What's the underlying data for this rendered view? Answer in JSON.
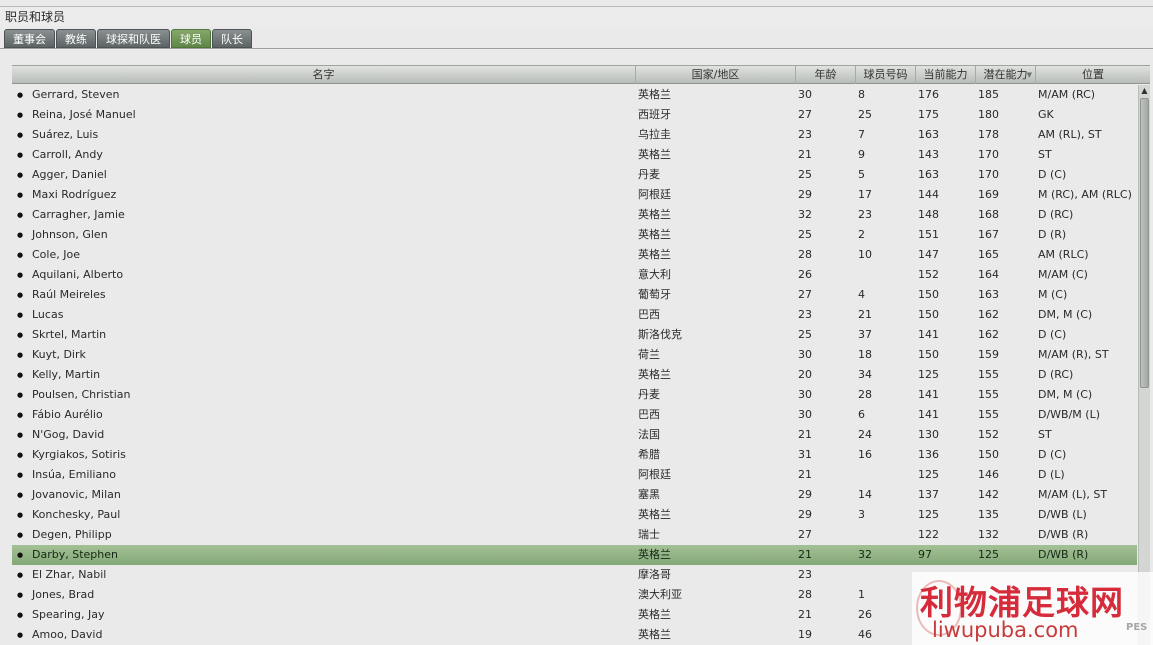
{
  "window": {
    "title": "职员和球员"
  },
  "tabs": [
    {
      "label": "董事会",
      "active": false
    },
    {
      "label": "教练",
      "active": false
    },
    {
      "label": "球探和队医",
      "active": false
    },
    {
      "label": "球员",
      "active": true
    },
    {
      "label": "队长",
      "active": false
    }
  ],
  "table": {
    "headers": {
      "name": "名字",
      "country": "国家/地区",
      "age": "年龄",
      "shirt": "球员号码",
      "ca": "当前能力",
      "pa": "潜在能力",
      "pos": "位置"
    },
    "sorted_by": "pa",
    "sort_icon": "sort-descending-icon",
    "selected_row": 23,
    "rows": [
      {
        "name": "Gerrard, Steven",
        "country": "英格兰",
        "age": "30",
        "shirt": "8",
        "ca": "176",
        "pa": "185",
        "pos": "M/AM (RC)"
      },
      {
        "name": "Reina, José Manuel",
        "country": "西班牙",
        "age": "27",
        "shirt": "25",
        "ca": "175",
        "pa": "180",
        "pos": "GK"
      },
      {
        "name": "Suárez, Luis",
        "country": "乌拉圭",
        "age": "23",
        "shirt": "7",
        "ca": "163",
        "pa": "178",
        "pos": "AM (RL), ST"
      },
      {
        "name": "Carroll, Andy",
        "country": "英格兰",
        "age": "21",
        "shirt": "9",
        "ca": "143",
        "pa": "170",
        "pos": "ST"
      },
      {
        "name": "Agger, Daniel",
        "country": "丹麦",
        "age": "25",
        "shirt": "5",
        "ca": "163",
        "pa": "170",
        "pos": "D (C)"
      },
      {
        "name": "Maxi Rodríguez",
        "country": "阿根廷",
        "age": "29",
        "shirt": "17",
        "ca": "144",
        "pa": "169",
        "pos": "M (RC), AM (RLC)"
      },
      {
        "name": "Carragher, Jamie",
        "country": "英格兰",
        "age": "32",
        "shirt": "23",
        "ca": "148",
        "pa": "168",
        "pos": "D (RC)"
      },
      {
        "name": "Johnson, Glen",
        "country": "英格兰",
        "age": "25",
        "shirt": "2",
        "ca": "151",
        "pa": "167",
        "pos": "D (R)"
      },
      {
        "name": "Cole, Joe",
        "country": "英格兰",
        "age": "28",
        "shirt": "10",
        "ca": "147",
        "pa": "165",
        "pos": "AM (RLC)"
      },
      {
        "name": "Aquilani, Alberto",
        "country": "意大利",
        "age": "26",
        "shirt": "",
        "ca": "152",
        "pa": "164",
        "pos": "M/AM (C)"
      },
      {
        "name": "Raúl Meireles",
        "country": "葡萄牙",
        "age": "27",
        "shirt": "4",
        "ca": "150",
        "pa": "163",
        "pos": "M (C)"
      },
      {
        "name": "Lucas",
        "country": "巴西",
        "age": "23",
        "shirt": "21",
        "ca": "150",
        "pa": "162",
        "pos": "DM, M (C)"
      },
      {
        "name": "Skrtel, Martin",
        "country": "斯洛伐克",
        "age": "25",
        "shirt": "37",
        "ca": "141",
        "pa": "162",
        "pos": "D (C)"
      },
      {
        "name": "Kuyt, Dirk",
        "country": "荷兰",
        "age": "30",
        "shirt": "18",
        "ca": "150",
        "pa": "159",
        "pos": "M/AM (R), ST"
      },
      {
        "name": "Kelly, Martin",
        "country": "英格兰",
        "age": "20",
        "shirt": "34",
        "ca": "125",
        "pa": "155",
        "pos": "D (RC)"
      },
      {
        "name": "Poulsen, Christian",
        "country": "丹麦",
        "age": "30",
        "shirt": "28",
        "ca": "141",
        "pa": "155",
        "pos": "DM, M (C)"
      },
      {
        "name": "Fábio Aurélio",
        "country": "巴西",
        "age": "30",
        "shirt": "6",
        "ca": "141",
        "pa": "155",
        "pos": "D/WB/M (L)"
      },
      {
        "name": "N'Gog, David",
        "country": "法国",
        "age": "21",
        "shirt": "24",
        "ca": "130",
        "pa": "152",
        "pos": "ST"
      },
      {
        "name": "Kyrgiakos, Sotiris",
        "country": "希腊",
        "age": "31",
        "shirt": "16",
        "ca": "136",
        "pa": "150",
        "pos": "D (C)"
      },
      {
        "name": "Insúa, Emiliano",
        "country": "阿根廷",
        "age": "21",
        "shirt": "",
        "ca": "125",
        "pa": "146",
        "pos": "D (L)"
      },
      {
        "name": "Jovanovic, Milan",
        "country": "塞黑",
        "age": "29",
        "shirt": "14",
        "ca": "137",
        "pa": "142",
        "pos": "M/AM (L), ST"
      },
      {
        "name": "Konchesky, Paul",
        "country": "英格兰",
        "age": "29",
        "shirt": "3",
        "ca": "125",
        "pa": "135",
        "pos": "D/WB (L)"
      },
      {
        "name": "Degen, Philipp",
        "country": "瑞士",
        "age": "27",
        "shirt": "",
        "ca": "122",
        "pa": "132",
        "pos": "D/WB (R)"
      },
      {
        "name": "Darby, Stephen",
        "country": "英格兰",
        "age": "21",
        "shirt": "32",
        "ca": "97",
        "pa": "125",
        "pos": "D/WB (R)"
      },
      {
        "name": "El Zhar, Nabil",
        "country": "摩洛哥",
        "age": "23",
        "shirt": "",
        "ca": "",
        "pa": "",
        "pos": ""
      },
      {
        "name": "Jones, Brad",
        "country": "澳大利亚",
        "age": "28",
        "shirt": "1",
        "ca": "",
        "pa": "",
        "pos": ""
      },
      {
        "name": "Spearing, Jay",
        "country": "英格兰",
        "age": "21",
        "shirt": "26",
        "ca": "",
        "pa": "",
        "pos": ""
      },
      {
        "name": "Amoo, David",
        "country": "英格兰",
        "age": "19",
        "shirt": "46",
        "ca": "",
        "pa": "",
        "pos": ""
      }
    ]
  },
  "watermark": {
    "cn": "利物浦足球网",
    "url": "liwupuba.com",
    "badge": "PES"
  },
  "colors": {
    "tab_active": "#6f9857",
    "tab_inactive": "#747b7c",
    "row_selected": "#95b688",
    "watermark_red": "#d62b3a"
  }
}
